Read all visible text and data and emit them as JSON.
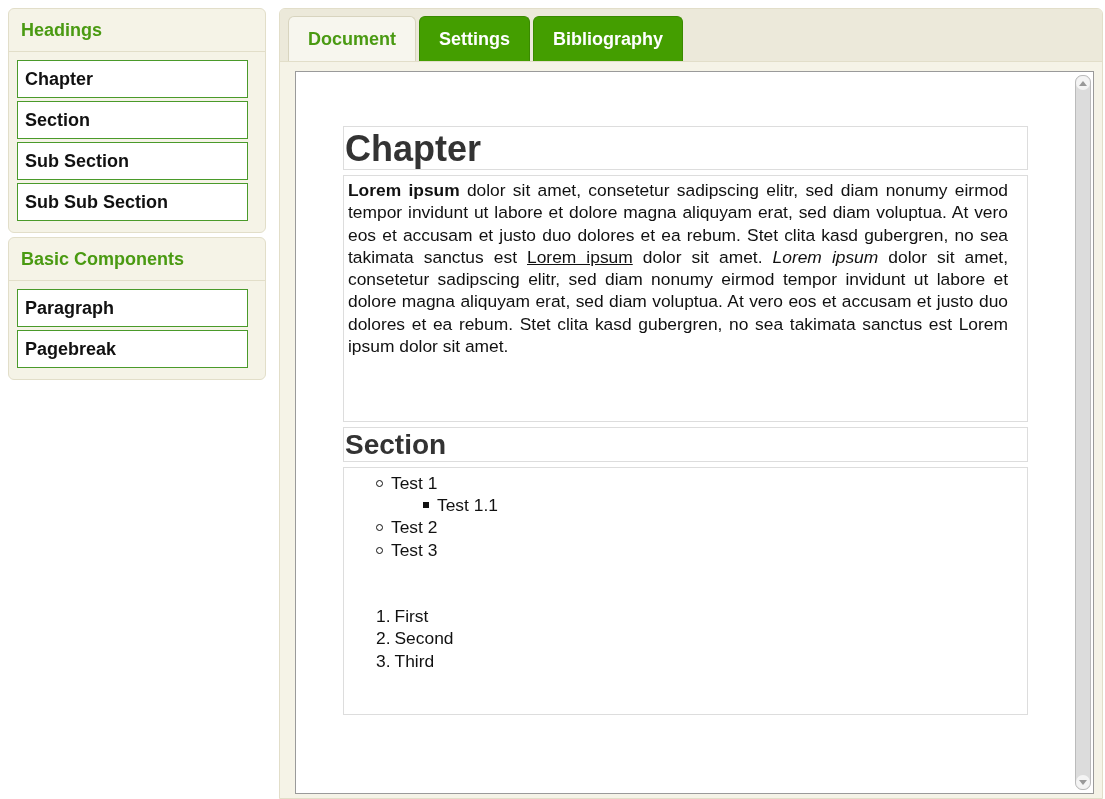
{
  "sidebar": {
    "groups": [
      {
        "title": "Headings",
        "items": [
          "Chapter",
          "Section",
          "Sub Section",
          "Sub Sub Section"
        ]
      },
      {
        "title": "Basic Components",
        "items": [
          "Paragraph",
          "Pagebreak"
        ]
      }
    ]
  },
  "tabs": [
    {
      "label": "Document",
      "selected": true
    },
    {
      "label": "Settings",
      "selected": false
    },
    {
      "label": "Bibliography",
      "selected": false
    }
  ],
  "document": {
    "blocks": [
      {
        "kind": "heading1",
        "text": "Chapter"
      },
      {
        "kind": "paragraph",
        "parts": [
          {
            "kind": "text",
            "text": "**Lorem ipsum** dolor sit amet, consetetur sadipscing elitr, sed diam nonumy eirmod tempor invidunt ut labore et dolore magna aliquyam erat, sed diam voluptua. At vero eos et accusam et justo duo dolores et ea rebum. Stet clita kasd gubergren, no sea takimata sanctus est "
          },
          {
            "kind": "link",
            "text": "Lorem ipsum"
          },
          {
            "kind": "text",
            "text": " dolor sit amet. *Lorem ipsum* dolor sit amet, consetetur sadipscing elitr, sed diam nonumy eirmod tempor invidunt ut labore et dolore magna aliquyam erat, sed diam voluptua. At vero eos et accusam et justo duo dolores et ea rebum. Stet clita kasd gubergren, no sea takimata sanctus est Lorem ipsum dolor sit amet."
          }
        ]
      },
      {
        "kind": "heading2",
        "text": "Section"
      },
      {
        "kind": "lists",
        "bullets": [
          {
            "text": "Test 1",
            "children": [
              {
                "text": "Test 1.1"
              }
            ]
          },
          {
            "text": "Test 2"
          },
          {
            "text": "Test 3"
          }
        ],
        "numbered": [
          {
            "number": "1.",
            "text": "First"
          },
          {
            "number": "2.",
            "text": "Second"
          },
          {
            "number": "3.",
            "text": "Third"
          }
        ]
      }
    ]
  }
}
